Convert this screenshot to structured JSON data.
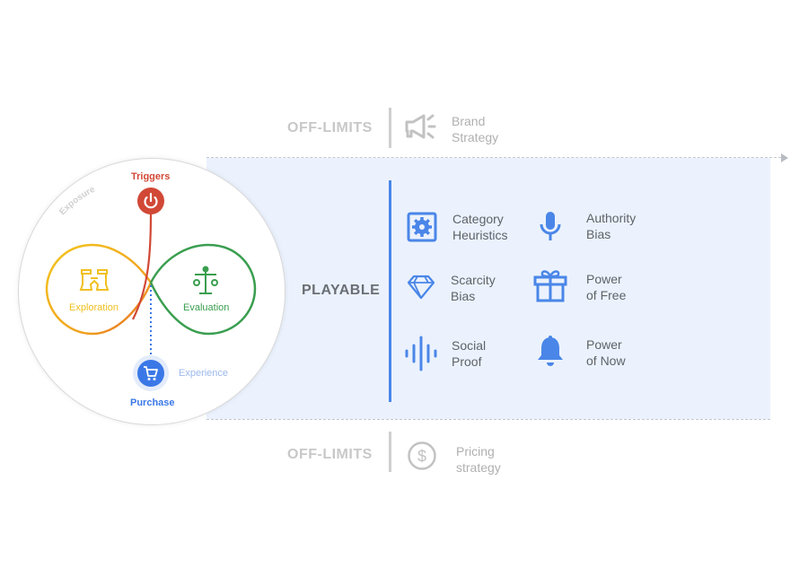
{
  "colors": {
    "accent_blue": "#4a86e8",
    "playable_band": "#ebf2fd",
    "off_limits_gray": "#c8c8c8",
    "triggers_red": "#d14836",
    "exploration_yellow": "#f0c020",
    "evaluation_green": "#3a9e4f",
    "purchase_blue": "#3b78e7"
  },
  "off_limits_top": {
    "label": "OFF-LIMITS",
    "icon": "megaphone-icon",
    "text_line1": "Brand",
    "text_line2": "Strategy"
  },
  "off_limits_bottom": {
    "label": "OFF-LIMITS",
    "icon": "dollar-circle-icon",
    "text_line1": "Pricing",
    "text_line2": "strategy"
  },
  "playable": {
    "label": "PLAYABLE",
    "items": [
      {
        "icon": "gear-box-icon",
        "line1": "Category",
        "line2": "Heuristics"
      },
      {
        "icon": "microphone-icon",
        "line1": "Authority",
        "line2": "Bias"
      },
      {
        "icon": "diamond-icon",
        "line1": "Scarcity",
        "line2": "Bias"
      },
      {
        "icon": "gift-icon",
        "line1": "Power",
        "line2": "of Free"
      },
      {
        "icon": "soundwave-icon",
        "line1": "Social",
        "line2": "Proof"
      },
      {
        "icon": "bell-icon",
        "line1": "Power",
        "line2": "of Now"
      }
    ]
  },
  "journey": {
    "exposure": "Exposure",
    "triggers": "Triggers",
    "exploration": "Exploration",
    "evaluation": "Evaluation",
    "purchase": "Purchase",
    "experience": "Experience"
  }
}
